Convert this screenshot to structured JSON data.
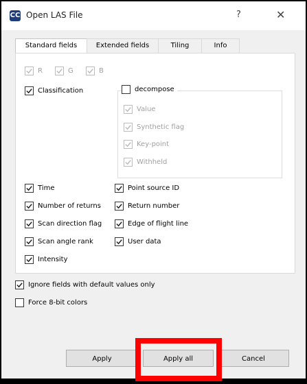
{
  "window": {
    "title": "Open LAS File",
    "app_icon_text": "CC",
    "help_label": "?",
    "close_label": "✕"
  },
  "tabs": [
    {
      "label": "Standard fields",
      "active": true
    },
    {
      "label": "Extended fields",
      "active": false
    },
    {
      "label": "Tiling",
      "active": false
    },
    {
      "label": "Info",
      "active": false
    }
  ],
  "rgb": [
    {
      "label": "R",
      "checked": true,
      "enabled": false
    },
    {
      "label": "G",
      "checked": true,
      "enabled": false
    },
    {
      "label": "B",
      "checked": true,
      "enabled": false
    }
  ],
  "classification": {
    "label": "Classification",
    "checked": true
  },
  "decompose": {
    "label": "decompose",
    "checked": false,
    "items": [
      {
        "label": "Value",
        "checked": true,
        "enabled": false
      },
      {
        "label": "Synthetic flag",
        "checked": true,
        "enabled": false
      },
      {
        "label": "Key-point",
        "checked": true,
        "enabled": false
      },
      {
        "label": "Withheld",
        "checked": true,
        "enabled": false
      }
    ]
  },
  "fields_left": [
    {
      "label": "Time",
      "checked": true
    },
    {
      "label": "Number of returns",
      "checked": true
    },
    {
      "label": "Scan direction flag",
      "checked": true
    },
    {
      "label": "Scan angle rank",
      "checked": true
    },
    {
      "label": "Intensity",
      "checked": true
    }
  ],
  "fields_right": [
    {
      "label": "Point source ID",
      "checked": true
    },
    {
      "label": "Return number",
      "checked": true
    },
    {
      "label": "Edge of flight line",
      "checked": true
    },
    {
      "label": "User data",
      "checked": true
    }
  ],
  "options": {
    "ignore_default": {
      "label": "Ignore fields with default values only",
      "checked": true
    },
    "force_8bit": {
      "label": "Force 8-bit colors",
      "checked": false
    }
  },
  "buttons": {
    "apply": "Apply",
    "apply_all": "Apply all",
    "cancel": "Cancel"
  },
  "colors": {
    "highlight": "#ff0000",
    "app_icon": "#1f3d7a"
  }
}
